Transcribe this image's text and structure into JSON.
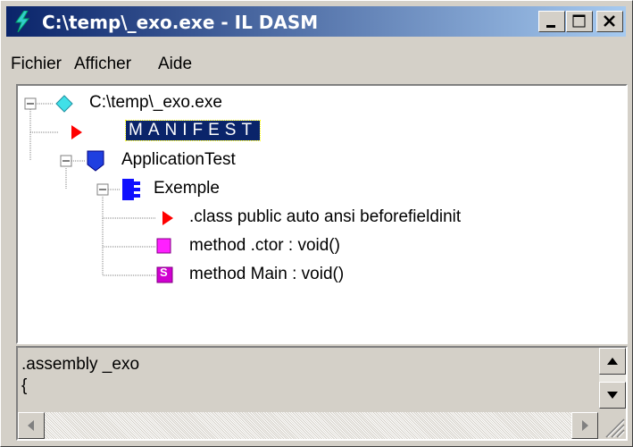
{
  "window": {
    "title": "C:\\temp\\_exo.exe - IL DASM",
    "controls": [
      "minimize",
      "maximize",
      "close"
    ]
  },
  "menu": {
    "items": [
      "Fichier",
      "Afficher",
      "Aide"
    ]
  },
  "tree": {
    "root": "C:\\temp\\_exo.exe",
    "manifest": "MANIFEST",
    "namespace": "ApplicationTest",
    "class": "Exemple",
    "class_decl": ".class public auto ansi beforefieldinit",
    "method_ctor": "method .ctor : void()",
    "method_main": "method Main : void()",
    "static_badge": "S"
  },
  "bottom": {
    "lines": [
      ".assembly _exo",
      "{"
    ]
  },
  "colors": {
    "title_start": "#0a246a",
    "title_end": "#a6caf0",
    "selection": "#0a246a",
    "face": "#d4d0c8"
  }
}
